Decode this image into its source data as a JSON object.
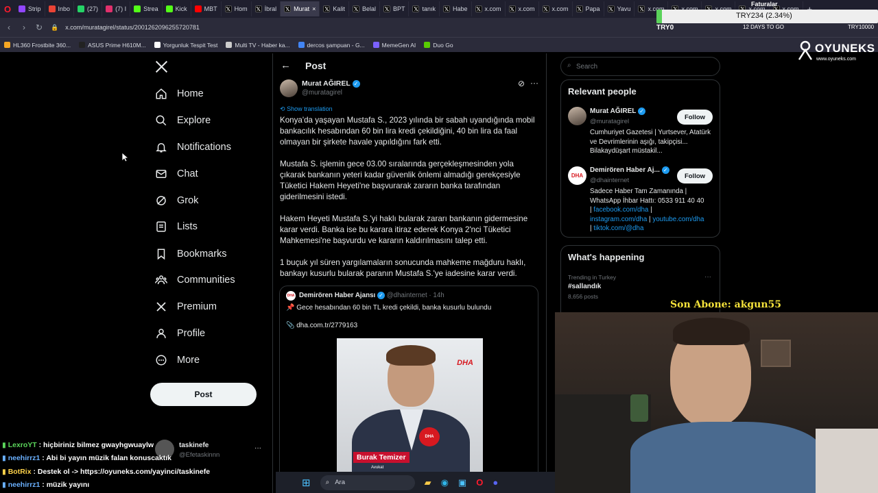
{
  "browser": {
    "tabs": [
      {
        "label": "Strip",
        "icon": "twitch-icon",
        "color": "#9146ff"
      },
      {
        "label": "Inbo",
        "icon": "gmail-icon",
        "color": "#ea4335"
      },
      {
        "label": "(27)",
        "icon": "whatsapp-icon",
        "color": "#25d366"
      },
      {
        "label": "(7) I",
        "icon": "instagram-icon",
        "color": "#e1306c"
      },
      {
        "label": "Strea",
        "icon": "kick-icon",
        "color": "#53fc18"
      },
      {
        "label": "Kick",
        "icon": "kick-icon",
        "color": "#53fc18"
      },
      {
        "label": "MBT",
        "icon": "youtube-icon",
        "color": "#ff0000"
      },
      {
        "label": "Hom",
        "icon": "x-icon",
        "color": "#000000"
      },
      {
        "label": "İbral",
        "icon": "x-icon",
        "color": "#000000"
      },
      {
        "label": "Murat",
        "icon": "x-icon",
        "color": "#000000",
        "active": true
      },
      {
        "label": "Kalit",
        "icon": "x-icon",
        "color": "#000000"
      },
      {
        "label": "Belal",
        "icon": "x-icon",
        "color": "#000000"
      },
      {
        "label": "BPT",
        "icon": "x-icon",
        "color": "#000000"
      },
      {
        "label": "tanık",
        "icon": "x-icon",
        "color": "#000000"
      },
      {
        "label": "Habe",
        "icon": "x-icon",
        "color": "#000000"
      },
      {
        "label": "x.com",
        "icon": "x-icon",
        "color": "#000000"
      },
      {
        "label": "x.com",
        "icon": "x-icon",
        "color": "#000000"
      },
      {
        "label": "x.com",
        "icon": "x-icon",
        "color": "#000000"
      },
      {
        "label": "Papa",
        "icon": "x-icon",
        "color": "#000000"
      },
      {
        "label": "Yavu",
        "icon": "x-icon",
        "color": "#000000"
      },
      {
        "label": "x.com",
        "icon": "x-icon",
        "color": "#000000"
      },
      {
        "label": "x.com",
        "icon": "x-icon",
        "color": "#000000"
      },
      {
        "label": "x.com",
        "icon": "x-icon",
        "color": "#000000"
      },
      {
        "label": "x.com",
        "icon": "x-icon",
        "color": "#000000"
      },
      {
        "label": "x.com",
        "icon": "x-icon",
        "color": "#000000"
      }
    ],
    "url": "x.com/muratagirel/status/2001262096255720781",
    "bookmarks": [
      {
        "label": "HL360 Frostbite 360...",
        "color": "#f5a623"
      },
      {
        "label": "ASUS Prime H610M...",
        "color": "#222222"
      },
      {
        "label": "Yorgunluk Tespit Test",
        "color": "#ffffff"
      },
      {
        "label": "Multi TV - Haber ka...",
        "color": "#cccccc"
      },
      {
        "label": "dercos şampuan - G...",
        "color": "#4285f4"
      },
      {
        "label": "MemeGen AI",
        "color": "#7b61ff"
      },
      {
        "label": "Duo Go",
        "color": "#58cc02"
      }
    ]
  },
  "ticker": {
    "symbol": "TRY0",
    "value": "TRY234 (2.34%)",
    "days_label": "12 DAYS TO GO",
    "faturalar": "Faturalar",
    "right_tag": "TRY10000"
  },
  "brand": {
    "logo": "OYUNEKS",
    "url": "www.oyuneks.com"
  },
  "nav": {
    "items": [
      {
        "label": "Home",
        "icon": "home-icon"
      },
      {
        "label": "Explore",
        "icon": "search-icon"
      },
      {
        "label": "Notifications",
        "icon": "bell-icon"
      },
      {
        "label": "Chat",
        "icon": "mail-icon"
      },
      {
        "label": "Grok",
        "icon": "grok-icon"
      },
      {
        "label": "Lists",
        "icon": "list-icon"
      },
      {
        "label": "Bookmarks",
        "icon": "bookmark-icon"
      },
      {
        "label": "Communities",
        "icon": "communities-icon"
      },
      {
        "label": "Premium",
        "icon": "x-icon"
      },
      {
        "label": "Profile",
        "icon": "person-icon"
      },
      {
        "label": "More",
        "icon": "more-circle-icon"
      }
    ],
    "post_button": "Post",
    "account_name": "taskinefe",
    "account_handle": "@Efetaskinnn",
    "account_more": "···"
  },
  "post": {
    "header": "Post",
    "author": "Murat AĞIREL",
    "handle": "@muratagirel",
    "show_translation": "Show translation",
    "paragraphs": [
      "Konya'da yaşayan Mustafa S., 2023 yılında bir sabah uyandığında mobil bankacılık hesabından 60 bin lira kredi çekildiğini, 40 bin lira da faal olmayan bir şirkete havale yapıldığını fark etti.",
      "Mustafa S. işlemin gece 03.00 sıralarında gerçekleşmesinden yola çıkarak bankanın yeteri kadar güvenlik önlemi almadığı gerekçesiyle Tüketici Hakem Heyeti'ne başvurarak zararın banka tarafından giderilmesini istedi.",
      "Hakem Heyeti Mustafa S.'yi haklı bularak zararı bankanın gidermesine karar verdi. Banka ise bu karara itiraz ederek Konya 2'nci Tüketici Mahkemesi'ne başvurdu ve kararın kaldırılmasını talep etti.",
      "1 buçuk yıl süren yargılamaların sonucunda mahkeme mağduru haklı, bankayı kusurlu bularak paranın Mustafa S.'ye iadesine karar verdi."
    ],
    "quote": {
      "author": "Demirören Haber Ajansı",
      "handle": "@dhainternet",
      "time": "· 14h",
      "text": "📌 Gece hesabından 60 bin TL kredi çekildi, banka kusurlu bulundu",
      "link": "📎 dha.com.tr/2779163",
      "image_caption": "Burak Temizer",
      "image_subcaption": "Avukat",
      "image_brand": "DHA"
    }
  },
  "right": {
    "search_placeholder": "Search",
    "relevant_title": "Relevant people",
    "people": [
      {
        "name": "Murat AĞIREL",
        "handle": "@muratagirel",
        "bio": "Cumhuriyet Gazetesi | Yurtsever, Atatürk ve Devrimlerinin aşığı, takipçisi... Bilakaydüşart müstakil...",
        "follow": "Follow"
      },
      {
        "name": "Demirören Haber Aj...",
        "handle": "@dhainternet",
        "bio_lines": [
          "Sadece Haber Tam Zamanında |",
          "WhatsApp İhbar Hattı: 0533 911 40 40"
        ],
        "links": [
          "facebook.com/dha",
          "instagram.com/dha",
          "youtube.com/dha",
          "tiktok.com/@dha"
        ],
        "follow": "Follow"
      }
    ],
    "happening_title": "What's happening",
    "trend_meta": "Trending in Turkey",
    "trend_name": "#sallandık",
    "trend_posts": "8,656 posts"
  },
  "overlay": {
    "subscriber": "Son Abone: akgun55",
    "chat": [
      {
        "user": "LexroYT",
        "text": " : hiçbiriniz bilmez gwayhgwuaylw",
        "color": "#5bd65b"
      },
      {
        "user": "neehirrz1",
        "text": " : Abi bi yayın müzik falan konuscaktık",
        "color": "#6ab0ff"
      },
      {
        "user": "BotRix",
        "text": " : Destek ol -> https://oyuneks.com/yayinci/taskinefe",
        "color": "#ffd24a"
      },
      {
        "user": "neehirrz1",
        "text": " : müzik yayını",
        "color": "#6ab0ff"
      }
    ],
    "taskbar_search": "Ara"
  }
}
